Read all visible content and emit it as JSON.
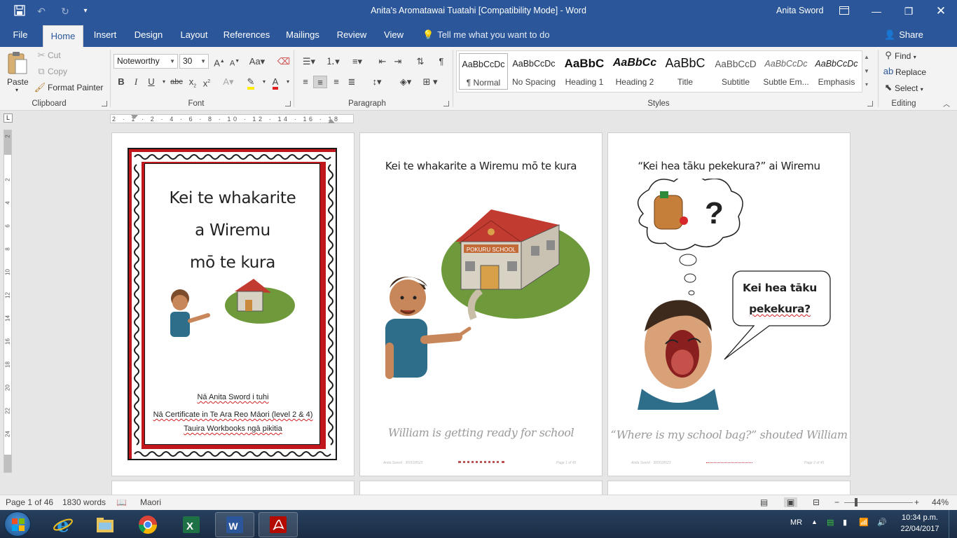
{
  "window": {
    "title": "Anita's Aromatawai Tuatahi [Compatibility Mode]  -  Word",
    "user": "Anita Sword"
  },
  "tabs": [
    {
      "label": "File"
    },
    {
      "label": "Home"
    },
    {
      "label": "Insert"
    },
    {
      "label": "Design"
    },
    {
      "label": "Layout"
    },
    {
      "label": "References"
    },
    {
      "label": "Mailings"
    },
    {
      "label": "Review"
    },
    {
      "label": "View"
    }
  ],
  "tell_me": "Tell me what you want to do",
  "share": "Share",
  "clipboard": {
    "paste": "Paste",
    "cut": "Cut",
    "copy": "Copy",
    "format_painter": "Format Painter",
    "label": "Clipboard"
  },
  "font": {
    "name": "Noteworthy",
    "size": "30",
    "label": "Font"
  },
  "paragraph": {
    "label": "Paragraph"
  },
  "styles": {
    "label": "Styles",
    "items": [
      {
        "sample": "AaBbCcDc",
        "name": "¶ Normal"
      },
      {
        "sample": "AaBbCcDc",
        "name": "No Spacing"
      },
      {
        "sample": "AaBbC",
        "name": "Heading 1"
      },
      {
        "sample": "AaBbCc",
        "name": "Heading 2"
      },
      {
        "sample": "AaBbC",
        "name": "Title"
      },
      {
        "sample": "AaBbCcD",
        "name": "Subtitle"
      },
      {
        "sample": "AaBbCcDc",
        "name": "Subtle Em..."
      },
      {
        "sample": "AaBbCcDc",
        "name": "Emphasis"
      }
    ]
  },
  "editing": {
    "find": "Find",
    "replace": "Replace",
    "select": "Select",
    "label": "Editing"
  },
  "ruler": {
    "numbers": "2 · 1 · 2 · 4 · 6 · 8 · 10 · 12 · 14 · 16 · 18",
    "vertical": [
      "2",
      "2",
      "4",
      "6",
      "8",
      "10",
      "12",
      "14",
      "16",
      "18",
      "20",
      "22",
      "24"
    ]
  },
  "page1": {
    "title_lines": [
      "Kei te whakarite",
      "a Wiremu",
      "mō te kura"
    ],
    "credit1": "Nā Anita Sword i tuhi",
    "credit2": "Nā Certificate in Te Ara Reo Māori (level 2 & 4)",
    "credit3": "Tauira Workbooks ngā pikitia"
  },
  "page2": {
    "heading": "Kei te whakarite a Wiremu mō te kura",
    "caption": "William is getting ready for school",
    "sign": "POKURU SCHOOL"
  },
  "page3": {
    "heading": "“Kei hea tāku pekekura?” ai Wiremu",
    "bubble_line1": "Kei hea tāku",
    "bubble_line2": "pekekura?",
    "caption": "“Where is my school bag?” shouted William"
  },
  "status": {
    "page": "Page 1 of 46",
    "words": "1830 words",
    "language": "Maori",
    "zoom": "44%"
  },
  "taskbar": {
    "lang": "MR",
    "time": "10:34 p.m.",
    "date": "22/04/2017"
  },
  "colors": {
    "brand": "#2b579a",
    "border_red": "#c0161c",
    "word_blue": "#2b579a"
  }
}
